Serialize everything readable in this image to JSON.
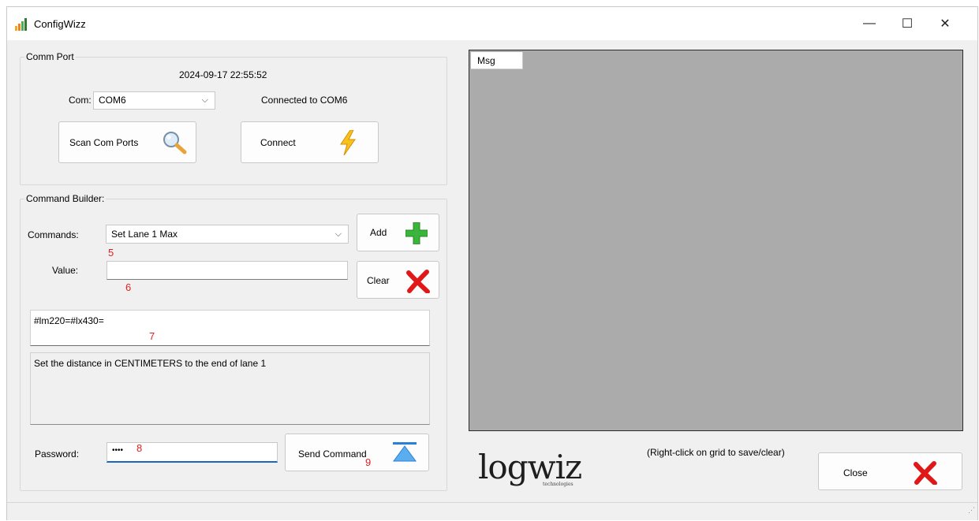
{
  "window": {
    "title": "ConfigWizz",
    "controls": {
      "minimize": "—",
      "maximize": "☐",
      "close": "✕"
    }
  },
  "comm_port": {
    "legend": "Comm Port",
    "timestamp": "2024-09-17 22:55:52",
    "com_label": "Com:",
    "com_value": "COM6",
    "status": "Connected to COM6",
    "scan_label": "Scan Com Ports",
    "connect_label": "Connect"
  },
  "command_builder": {
    "legend": "Command Builder:",
    "commands_label": "Commands:",
    "commands_value": "Set Lane 1 Max",
    "value_label": "Value:",
    "value_text": "",
    "add_label": "Add",
    "clear_label": "Clear",
    "command_string": "#lm220=#lx430=",
    "description": "Set the distance in CENTIMETERS to the end of lane 1",
    "password_label": "Password:",
    "password_value": "••••",
    "send_label": "Send Command"
  },
  "annotations": {
    "m5": "5",
    "m6": "6",
    "m7": "7",
    "m8": "8",
    "m9": "9"
  },
  "grid": {
    "column_header": "Msg",
    "hint": "(Right-click on grid to save/clear)"
  },
  "logo": {
    "text": "logwiz",
    "sub": "technologies"
  },
  "close_label": "Close",
  "colors": {
    "grid_bg": "#ababab",
    "annotation_red": "#e02020",
    "close_x_red": "#e01818",
    "add_green": "#3cb43c",
    "focus_blue": "#1a66c4"
  }
}
